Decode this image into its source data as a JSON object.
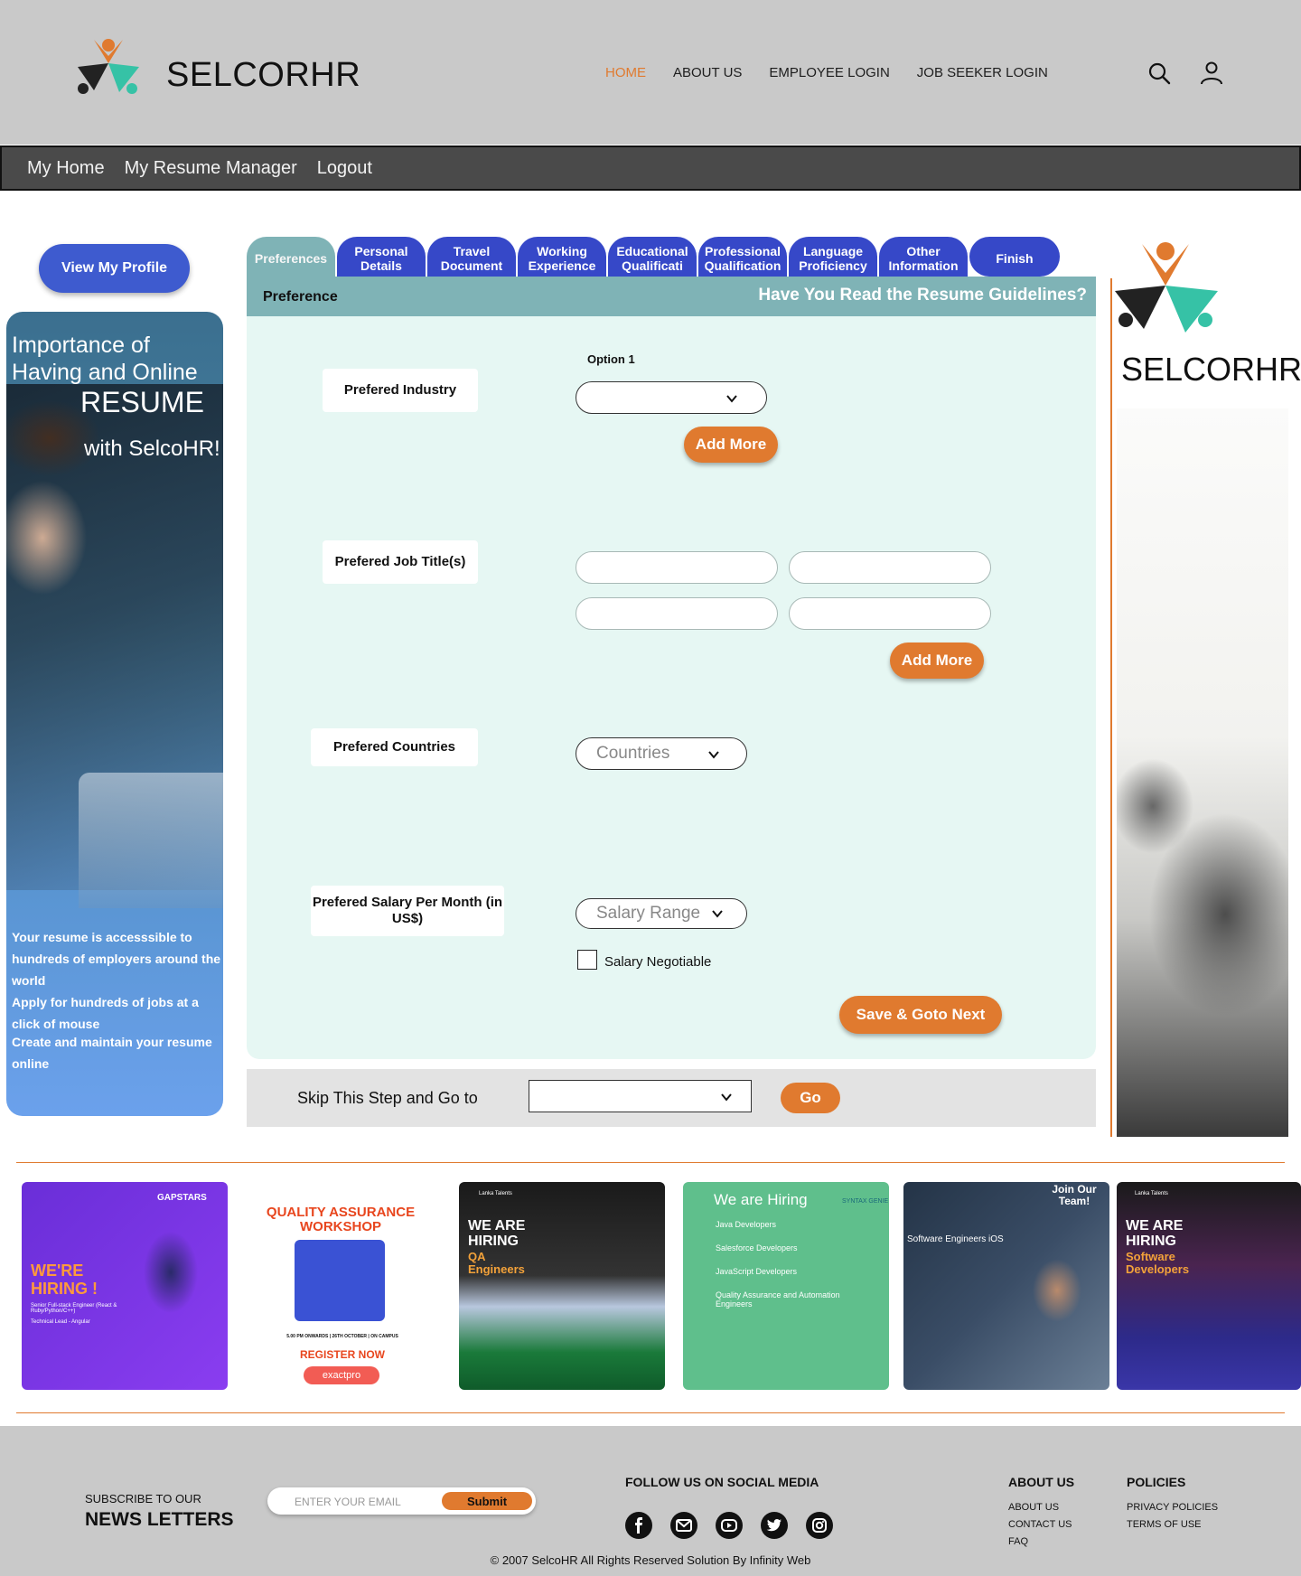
{
  "header": {
    "brand": "SELCORHR",
    "nav": [
      "HOME",
      "ABOUT US",
      "EMPLOYEE LOGIN",
      "JOB SEEKER LOGIN"
    ],
    "active_nav": "HOME",
    "icons": [
      "search-icon",
      "user-icon"
    ]
  },
  "subnav": [
    "My Home",
    "My Resume Manager",
    "Logout"
  ],
  "sidebar": {
    "view_profile": "View My Profile",
    "promo_line1": "Importance of",
    "promo_line2": "Having and  Online",
    "promo_line3": "RESUME",
    "promo_line4": "with SelcoHR!",
    "promo_b1": "Your resume is accesssible to hundreds of employers around the world",
    "promo_b2": "Apply for hundreds of jobs at a click of mouse",
    "promo_b3": "Create and maintain your resume online"
  },
  "tabs": [
    {
      "label": "Preferences",
      "active": true
    },
    {
      "label": "Personal Details"
    },
    {
      "label": "Travel Document"
    },
    {
      "label": "Working Experience"
    },
    {
      "label": "Educational Qualificati"
    },
    {
      "label": "Professional Qualification"
    },
    {
      "label": "Language Proficiency"
    },
    {
      "label": "Other Information"
    },
    {
      "label": "Finish"
    }
  ],
  "form": {
    "header_left": "Preference",
    "header_right": "Have You Read the Resume Guidelines?",
    "industry_label": "Prefered Industry",
    "option_label": "Option 1",
    "add_more": "Add More",
    "job_title_label": "Prefered Job Title(s)",
    "countries_label": "Prefered Countries",
    "countries_placeholder": "Countries",
    "salary_label": "Prefered Salary Per Month (in US$)",
    "salary_placeholder": "Salary Range",
    "salary_negotiable": "Salary Negotiable",
    "save_next": "Save & Goto Next"
  },
  "skip": {
    "text": "Skip This Step and Go to",
    "go": "Go"
  },
  "right": {
    "brand": "SELCORHR"
  },
  "ads": [
    {
      "brand": "GAPSTARS",
      "title": "WE'RE HIRING !",
      "sub": "Senior Full-stack Engineer (React & Ruby/Python/C++)",
      "sub2": "Technical Lead - Angular"
    },
    {
      "title": "QUALITY ASSURANCE WORKSHOP",
      "date": "5.00 PM ONWARDS | 26TH OCTOBER | ON CAMPUS",
      "cta": "REGISTER NOW",
      "brand": "exactpro"
    },
    {
      "title": "WE ARE HIRING",
      "role": "QA Engineers",
      "brand": "Lanka Talents"
    },
    {
      "title": "We are Hiring",
      "brand": "SYNTAX GENIE",
      "roles": [
        "Java Developers",
        "Salesforce Developers",
        "JavaScript Developers",
        "Quality Assurance and Automation Engineers"
      ]
    },
    {
      "title": "Join Our Team!",
      "role": "Software Engineers iOS"
    },
    {
      "title": "WE ARE HIRING",
      "role": "Software Developers",
      "brand": "Lanka Talents"
    }
  ],
  "footer": {
    "subscribe_small": "SUBSCRIBE TO OUR",
    "subscribe_big": "NEWS LETTERS",
    "email_placeholder": "ENTER YOUR EMAIL",
    "submit": "Submit",
    "follow": "FOLLOW US ON SOCIAL MEDIA",
    "about_head": "ABOUT US",
    "about_links": [
      "ABOUT US",
      "CONTACT US",
      "FAQ"
    ],
    "policies_head": "POLICIES",
    "policies_links": [
      "PRIVACY POLICIES",
      "TERMS OF  USE"
    ],
    "copyright": "© 2007 SelcoHR All Rights Reserved Solution By Infinity Web",
    "social_icons": [
      "facebook-icon",
      "mail-icon",
      "youtube-icon",
      "twitter-icon",
      "instagram-icon"
    ]
  },
  "colors": {
    "accent": "#e07a2f",
    "tab_blue": "#3648c8",
    "teal": "#7fb3b6",
    "form_bg": "#e6f7f3"
  }
}
